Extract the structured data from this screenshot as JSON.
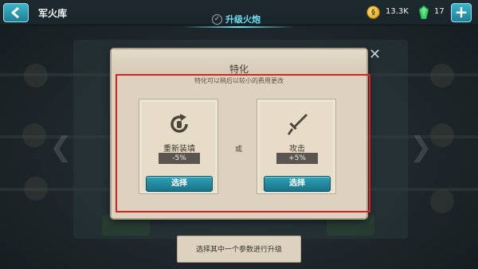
{
  "topbar": {
    "title": "军火库",
    "tab_label": "升级火炮",
    "coins": "13.3K",
    "gems": "17"
  },
  "dialog": {
    "title": "特化",
    "subtitle": "特化可以稍后以较小的费用更改",
    "or_label": "或",
    "options": [
      {
        "name": "重新装填",
        "value": "-5%",
        "button": "选择",
        "icon": "reload-icon"
      },
      {
        "name": "攻击",
        "value": "+5%",
        "button": "选择",
        "icon": "sword-icon"
      }
    ]
  },
  "hint": "选择其中一个参数进行升级",
  "colors": {
    "accent": "#2fa2b9",
    "highlight": "#e01e1e",
    "parchment": "#dcd2bf"
  }
}
